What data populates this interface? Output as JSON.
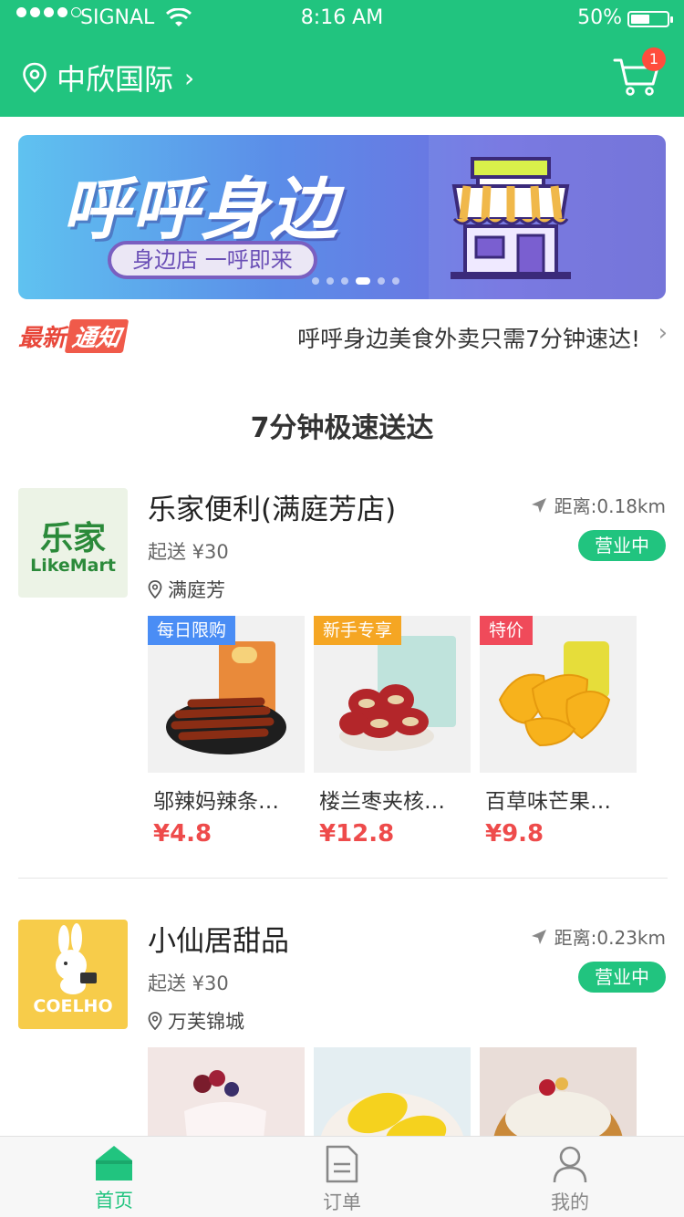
{
  "status_bar": {
    "carrier": "SIGNAL",
    "time": "8:16 AM",
    "battery": "50%",
    "battery_level": 0.5
  },
  "header": {
    "location": "中欣国际",
    "cart_count": "1"
  },
  "banner": {
    "title": "呼呼身边",
    "subtitle": "身边店 一呼即来",
    "slide_count": 6,
    "active_slide": 3
  },
  "notice": {
    "tag_a": "最新",
    "tag_b": "通知",
    "text": "呼呼身边美食外卖只需7分钟速达!"
  },
  "section_title": "7分钟极速送达",
  "stores": [
    {
      "name": "乐家便利(满庭芳店)",
      "distance": "距离:0.18km",
      "min_order": "起送 ¥30",
      "status": "营业中",
      "address": "满庭芳",
      "logo_text": [
        "乐家",
        "LikeMart"
      ],
      "products": [
        {
          "tag": "每日限购",
          "tag_color": "#4a8df5",
          "name": "邬辣妈辣条…",
          "price": "¥4.8",
          "image": "spicy-strips"
        },
        {
          "tag": "新手专享",
          "tag_color": "#f5a623",
          "name": "楼兰枣夹核…",
          "price": "¥12.8",
          "image": "dates-walnut"
        },
        {
          "tag": "特价",
          "tag_color": "#f04a5a",
          "name": "百草味芒果…",
          "price": "¥9.8",
          "image": "dried-mango"
        }
      ]
    },
    {
      "name": "小仙居甜品",
      "distance": "距离:0.23km",
      "min_order": "起送 ¥30",
      "status": "营业中",
      "address": "万芙锦城",
      "logo_text": [
        "COELHO"
      ],
      "products": [
        {
          "tag": "",
          "image": "berry-pudding"
        },
        {
          "tag": "",
          "image": "mango-dessert"
        },
        {
          "tag": "",
          "image": "coconut-sago"
        }
      ]
    }
  ],
  "tabbar": [
    {
      "label": "首页",
      "icon": "home-icon",
      "active": true
    },
    {
      "label": "订单",
      "icon": "order-icon",
      "active": false
    },
    {
      "label": "我的",
      "icon": "user-icon",
      "active": false
    }
  ],
  "colors": {
    "brand": "#21c47f",
    "price": "#ee4b4b",
    "badge": "#ff4d3d"
  }
}
